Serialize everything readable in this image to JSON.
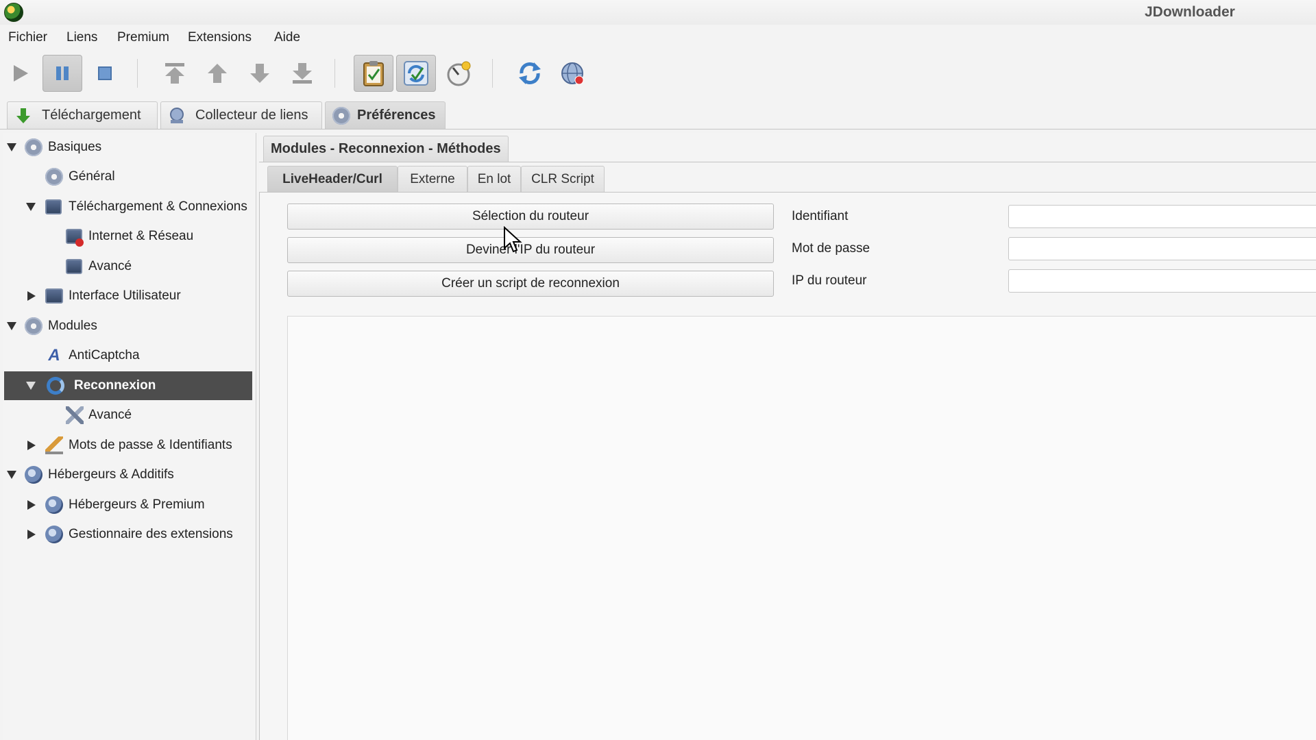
{
  "window": {
    "title": "JDownloader"
  },
  "menu": [
    "Fichier",
    "Liens",
    "Premium",
    "Extensions",
    "Aide"
  ],
  "toolbar": {
    "buttons": [
      "play-icon",
      "pause-icon",
      "stop-icon",
      "move-top-icon",
      "move-up-icon",
      "move-down-icon",
      "move-bottom-icon",
      "clipboard-icon",
      "auto-reconnect-icon",
      "speed-limit-icon",
      "reconnect-icon",
      "update-icon"
    ]
  },
  "main_tabs": [
    {
      "label": "Téléchargement",
      "icon": "download-arrow-icon",
      "active": false
    },
    {
      "label": "Collecteur de liens",
      "icon": "link-collector-icon",
      "active": false
    },
    {
      "label": "Préférences",
      "icon": "gear-icon",
      "active": true
    }
  ],
  "sidebar": {
    "items": [
      {
        "label": "Basiques",
        "icon": "gear-icon",
        "level": 0,
        "expander": "expanded"
      },
      {
        "label": "Général",
        "icon": "gear-icon",
        "level": 1,
        "expander": "none"
      },
      {
        "label": "Téléchargement & Connexions",
        "icon": "network-icon",
        "level": 1,
        "expander": "expanded"
      },
      {
        "label": "Internet & Réseau",
        "icon": "network-error-icon",
        "level": 2,
        "expander": "none"
      },
      {
        "label": "Avancé",
        "icon": "network-icon",
        "level": 2,
        "expander": "none"
      },
      {
        "label": "Interface Utilisateur",
        "icon": "monitor-icon",
        "level": 1,
        "expander": "collapsed"
      },
      {
        "label": "Modules",
        "icon": "gear-icon",
        "level": 0,
        "expander": "expanded"
      },
      {
        "label": "AntiCaptcha",
        "icon": "captcha-icon",
        "level": 1,
        "expander": "none"
      },
      {
        "label": "Reconnexion",
        "icon": "reconnect-icon",
        "level": 1,
        "expander": "expanded",
        "selected": true
      },
      {
        "label": "Avancé",
        "icon": "tools-icon",
        "level": 2,
        "expander": "none"
      },
      {
        "label": "Mots de passe & Identifiants",
        "icon": "password-icon",
        "level": 1,
        "expander": "collapsed"
      },
      {
        "label": "Hébergeurs & Additifs",
        "icon": "globe-icon",
        "level": 0,
        "expander": "expanded"
      },
      {
        "label": "Hébergeurs & Premium",
        "icon": "globe-icon",
        "level": 1,
        "expander": "collapsed"
      },
      {
        "label": "Gestionnaire des extensions",
        "icon": "globe-icon",
        "level": 1,
        "expander": "collapsed"
      }
    ]
  },
  "content": {
    "section_title": "Modules - Reconnexion - Méthodes",
    "subtabs": [
      {
        "label": "LiveHeader/Curl",
        "active": true
      },
      {
        "label": "Externe",
        "active": false
      },
      {
        "label": "En lot",
        "active": false
      },
      {
        "label": "CLR Script",
        "active": false
      }
    ],
    "buttons": {
      "select_router": "Sélection du routeur",
      "guess_ip": "Deviner l'IP du routeur",
      "create_script": "Créer un script de reconnexion"
    },
    "fields": {
      "username": {
        "label": "Identifiant",
        "value": ""
      },
      "password": {
        "label": "Mot de passe",
        "value": ""
      },
      "router_ip": {
        "label": "IP du routeur",
        "value": ""
      }
    },
    "script_text": ""
  }
}
